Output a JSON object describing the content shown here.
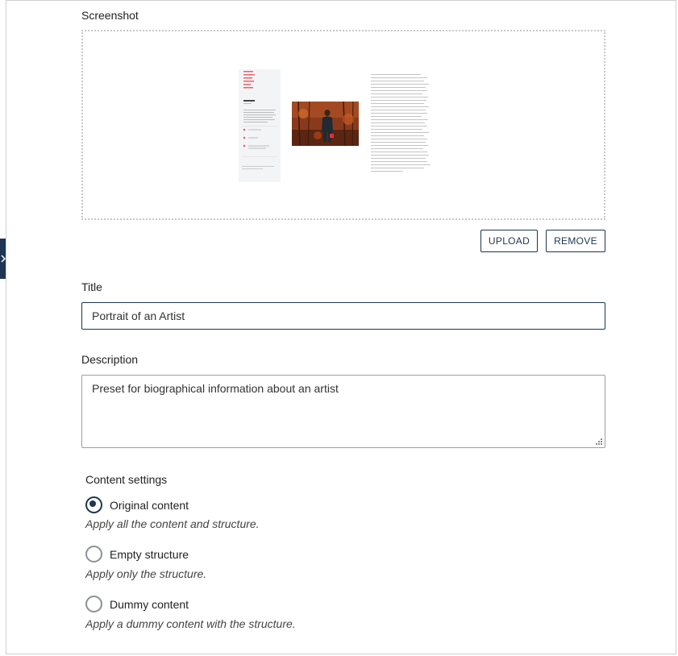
{
  "screenshot": {
    "label": "Screenshot",
    "upload_label": "UPLOAD",
    "remove_label": "REMOVE"
  },
  "title_field": {
    "label": "Title",
    "value": "Portrait of an Artist"
  },
  "description_field": {
    "label": "Description",
    "value": "Preset for biographical information about an artist"
  },
  "content_settings": {
    "label": "Content settings",
    "options": [
      {
        "label": "Original content",
        "hint": "Apply all the content and structure.",
        "checked": true
      },
      {
        "label": "Empty structure",
        "hint": "Apply only the structure.",
        "checked": false
      },
      {
        "label": "Dummy content",
        "hint": "Apply a dummy content with the structure.",
        "checked": false
      }
    ]
  },
  "colors": {
    "accent": "#1e3553",
    "thumbnail_link_red": "#e8606a"
  }
}
